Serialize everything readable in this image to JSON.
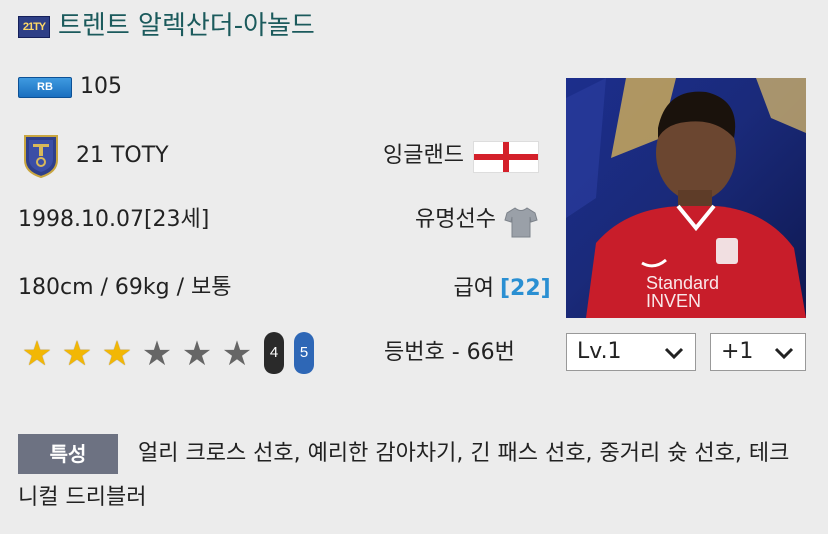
{
  "header": {
    "season_icon_text": "21TY",
    "player_name": "트렌트 알렉산더-아놀드"
  },
  "player": {
    "position": "RB",
    "ovr": "105",
    "season_name": "21 TOTY",
    "nation": "잉글랜드",
    "birth": "1998.10.07[23세]",
    "status": "유명선수",
    "body": "180cm / 69kg / 보통",
    "salary_label": "급여",
    "salary_value": "[22]",
    "star_rating": 3,
    "star_max": 7,
    "weak_foot": "4",
    "skill_foot": "5",
    "number_label": "등번호 - 66번",
    "portrait_watermark": "Standard\nINVEN"
  },
  "controls": {
    "level_value": "Lv.1",
    "upgrade_value": "+1"
  },
  "traits": {
    "tag": "특성",
    "text": "얼리 크로스 선호, 예리한 감아차기, 긴 패스 선호, 중거리 슛 선호, 테크니컬 드리블러"
  },
  "colors": {
    "name": "#1b5a5c",
    "salary": "#2a8fd2",
    "star_on": "#f2b705",
    "star_off": "#666666",
    "flag_red": "#d4202a",
    "tag_bg": "#6d7282"
  },
  "icons": {
    "season": "toty-season-icon",
    "crest": "toty-crest-icon",
    "flag": "england-flag-icon",
    "status": "shirt-icon",
    "chevron": "chevron-down-icon"
  }
}
